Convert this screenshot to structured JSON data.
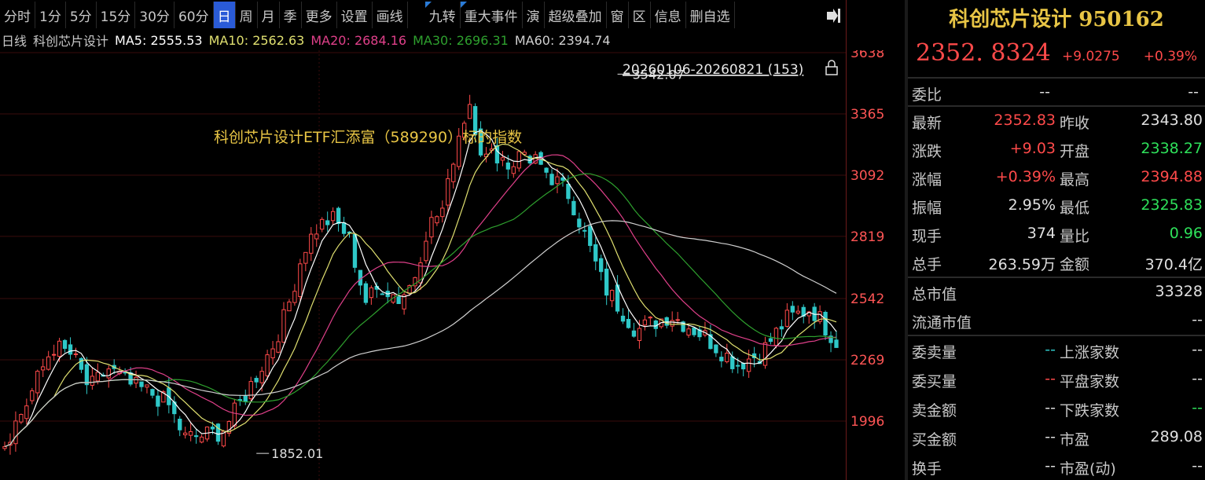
{
  "toolbar": {
    "tabs": [
      "分时",
      "1分",
      "5分",
      "15分",
      "30分",
      "60分",
      "日",
      "周",
      "月",
      "季",
      "更多",
      "设置",
      "画线"
    ],
    "active_tab": "日",
    "right_items": [
      "九转",
      "重大事件",
      "演",
      "超级叠加",
      "窗",
      "区",
      "信息",
      "删自选"
    ]
  },
  "ma_line": {
    "period": "日线",
    "name": "科创芯片设计",
    "ma5": "MA5: 2555.53",
    "ma10": "MA10: 2562.63",
    "ma20": "MA20: 2684.16",
    "ma30": "MA30: 2696.31",
    "ma60": "MA60: 2394.74"
  },
  "colors": {
    "up": "#ff4a4a",
    "down": "#2fc8c8",
    "ma5": "#ffffff",
    "ma10": "#e0e070",
    "ma20": "#e0408a",
    "ma30": "#2ea02e",
    "ma60": "#d0d0d0",
    "axis": "#ff5555",
    "annotation": "#e8c545"
  },
  "chart_data": {
    "type": "candlestick",
    "range_label": "20260106-20260821 (153)",
    "annotation": "科创芯片设计ETF汇添富（589290）标的指数",
    "y_ticks": [
      3638,
      3365,
      3092,
      2819,
      2542,
      2269,
      1996
    ],
    "high_label": "3542.07",
    "low_label": "1852.01",
    "ylim": [
      1852,
      3640
    ],
    "count": 153
  },
  "panel": {
    "title": "科创芯片设计 950162",
    "price": "2352. 8324",
    "change": "+9.0275",
    "change_pct": "+0.39%",
    "weibi": {
      "label": "委比",
      "v1": "--",
      "v2": "--"
    },
    "rows": [
      {
        "l1": "最新",
        "v1": "2352.83",
        "c1": "up",
        "l2": "昨收",
        "v2": "2343.80",
        "c2": "wt"
      },
      {
        "l1": "涨跌",
        "v1": "+9.03",
        "c1": "up",
        "l2": "开盘",
        "v2": "2338.27",
        "c2": "dn"
      },
      {
        "l1": "涨幅",
        "v1": "+0.39%",
        "c1": "up",
        "l2": "最高",
        "v2": "2394.88",
        "c2": "up"
      },
      {
        "l1": "振幅",
        "v1": "2.95%",
        "c1": "wt",
        "l2": "最低",
        "v2": "2325.83",
        "c2": "dn"
      },
      {
        "l1": "现手",
        "v1": "374",
        "c1": "wt",
        "l2": "量比",
        "v2": "0.96",
        "c2": "dn"
      },
      {
        "l1": "总手",
        "v1": "263.59万",
        "c1": "wt",
        "l2": "金额",
        "v2": "370.4亿",
        "c2": "wt"
      }
    ],
    "market_cap": {
      "label": "总市值",
      "value": "33328"
    },
    "float_cap": {
      "label": "流通市值",
      "value": "--"
    },
    "bottom_rows": [
      {
        "l1": "委卖量",
        "v1": "--",
        "c1": "cy",
        "l2": "上涨家数",
        "v2": "--",
        "c2": "wt"
      },
      {
        "l1": "委买量",
        "v1": "--",
        "c1": "up",
        "l2": "平盘家数",
        "v2": "--",
        "c2": "wt"
      },
      {
        "l1": "卖金额",
        "v1": "--",
        "c1": "wt",
        "l2": "下跌家数",
        "v2": "--",
        "c2": "dn"
      },
      {
        "l1": "买金额",
        "v1": "--",
        "c1": "wt",
        "l2": "市盈",
        "v2": "289.08",
        "c2": "wt"
      },
      {
        "l1": "换手",
        "v1": "--",
        "c1": "wt",
        "l2": "市盈(动)",
        "v2": "--",
        "c2": "wt"
      }
    ]
  }
}
